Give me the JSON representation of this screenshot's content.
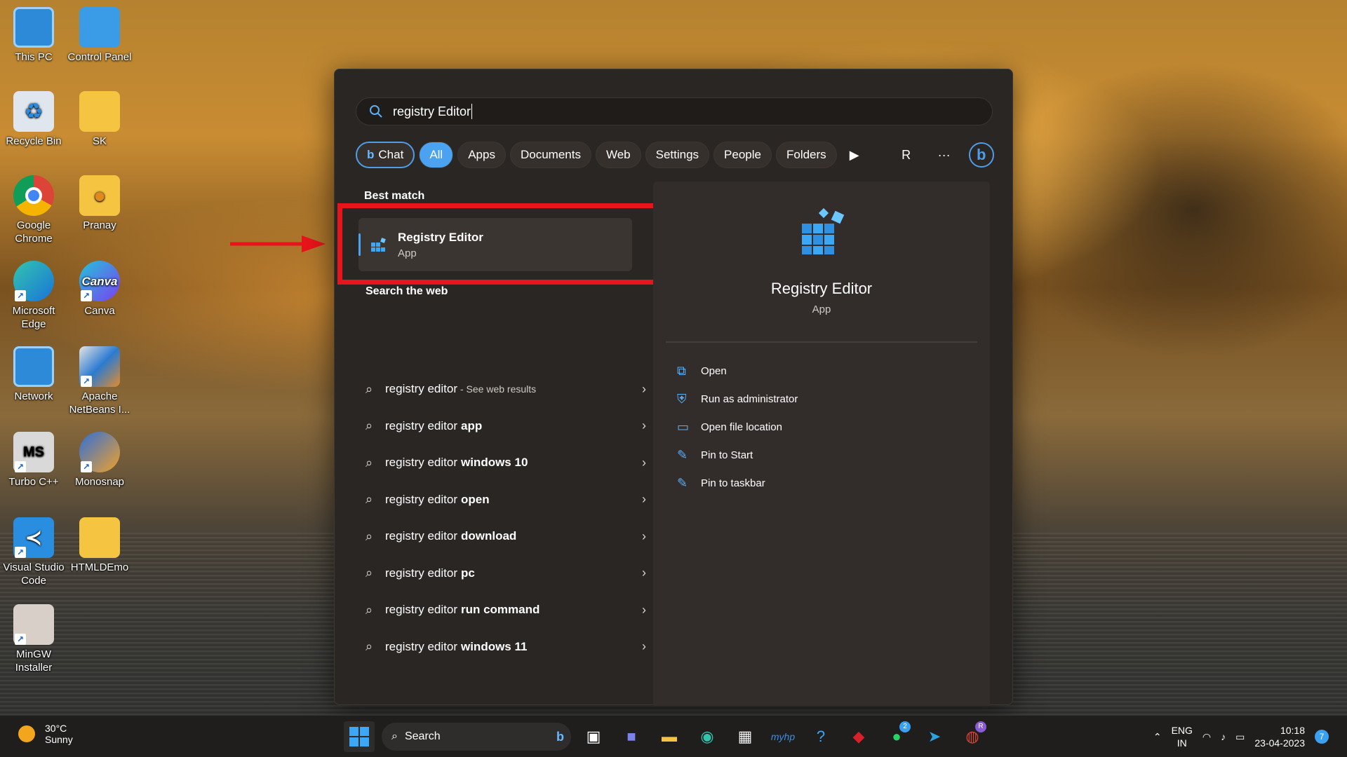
{
  "desktop": {
    "icons": [
      {
        "label": "This PC",
        "icon": "monitor-icon"
      },
      {
        "label": "Control Panel",
        "icon": "control-panel-icon"
      },
      {
        "label": "Recycle Bin",
        "icon": "recycle-bin-icon"
      },
      {
        "label": "SK",
        "icon": "folder-icon"
      },
      {
        "label": "Google Chrome",
        "icon": "chrome-icon"
      },
      {
        "label": "Pranay",
        "icon": "user-folder-icon"
      },
      {
        "label": "Microsoft Edge",
        "icon": "edge-icon"
      },
      {
        "label": "Canva",
        "icon": "canva-icon"
      },
      {
        "label": "Network",
        "icon": "network-icon"
      },
      {
        "label": "Apache NetBeans I...",
        "icon": "netbeans-icon"
      },
      {
        "label": "Turbo C++",
        "icon": "turbo-cpp-icon"
      },
      {
        "label": "Monosnap",
        "icon": "monosnap-icon"
      },
      {
        "label": "Visual Studio Code",
        "icon": "vscode-icon"
      },
      {
        "label": "HTMLDEmo",
        "icon": "folder-icon"
      },
      {
        "label": "MinGW Installer",
        "icon": "mingw-icon"
      }
    ]
  },
  "search": {
    "query": "registry Editor",
    "filters": {
      "chat": "Chat",
      "all": "All",
      "apps": "Apps",
      "documents": "Documents",
      "web": "Web",
      "settings": "Settings",
      "people": "People",
      "folders": "Folders",
      "account_initial": "R",
      "more": "···"
    },
    "best_match": {
      "heading": "Best match",
      "title": "Registry Editor",
      "subtitle": "App"
    },
    "web": {
      "heading": "Search the web",
      "items": [
        {
          "prefix": "registry editor",
          "bold": "",
          "suffix": "- See web results"
        },
        {
          "prefix": "registry editor",
          "bold": "app",
          "suffix": ""
        },
        {
          "prefix": "registry editor",
          "bold": "windows 10",
          "suffix": ""
        },
        {
          "prefix": "registry editor",
          "bold": "open",
          "suffix": ""
        },
        {
          "prefix": "registry editor",
          "bold": "download",
          "suffix": ""
        },
        {
          "prefix": "registry editor",
          "bold": "pc",
          "suffix": ""
        },
        {
          "prefix": "registry editor",
          "bold": "run command",
          "suffix": ""
        },
        {
          "prefix": "registry editor",
          "bold": "windows 11",
          "suffix": ""
        }
      ]
    },
    "detail": {
      "title": "Registry Editor",
      "subtitle": "App",
      "actions": [
        {
          "label": "Open",
          "icon": "open-icon"
        },
        {
          "label": "Run as administrator",
          "icon": "shield-icon"
        },
        {
          "label": "Open file location",
          "icon": "folder-icon"
        },
        {
          "label": "Pin to Start",
          "icon": "pin-icon"
        },
        {
          "label": "Pin to taskbar",
          "icon": "pin-icon"
        }
      ]
    }
  },
  "taskbar": {
    "weather_temp": "30°C",
    "weather_desc": "Sunny",
    "search_label": "Search",
    "whatsapp_badge": "2",
    "chrome_badge": "R",
    "lang_top": "ENG",
    "lang_bottom": "IN",
    "time": "10:18",
    "date": "23-04-2023",
    "notifications": "7"
  },
  "colors": {
    "accent": "#4aa2f0",
    "highlight_box": "#e8141b"
  }
}
